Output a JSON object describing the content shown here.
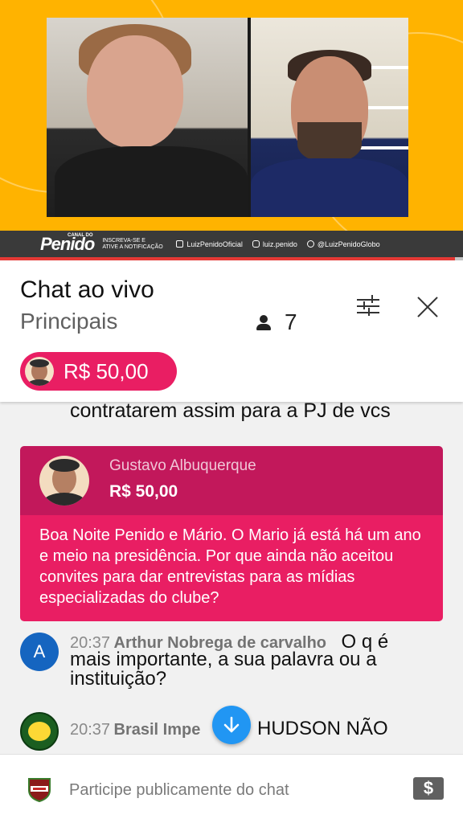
{
  "video": {
    "banner": {
      "channel_prefix": "CANAL DO",
      "logo": "Penido",
      "subscribe_line1": "INSCREVA-SE E",
      "subscribe_line2": "ATIVE A NOTIFICAÇÃO",
      "facebook": "LuizPenidoOficial",
      "instagram": "luiz.penido",
      "twitter": "@LuizPenidoGlobo"
    }
  },
  "header": {
    "title": "Chat ao vivo",
    "subtitle": "Principais",
    "viewer_count": "7",
    "pinned_superchat_amount": "R$ 50,00"
  },
  "chat": {
    "previous_message_tail": "contratarem assim para a PJ de vcs",
    "superchat": {
      "author": "Gustavo Albuquerque",
      "amount": "R$ 50,00",
      "message": "Boa Noite Penido e Mário. O Mario já está há um ano e meio na presidência. Por que ainda não aceitou convites para dar entrevistas para as mídias especializadas do clube?"
    },
    "messages": [
      {
        "avatar_letter": "A",
        "time": "20:37",
        "author": "Arthur Nobrega de carvalho",
        "text_start": "O q é",
        "text_rest": "mais importante, a sua palavra ou a instituição?"
      },
      {
        "time": "20:37",
        "author": "Brasil Impe",
        "text": "HUDSON NÃO"
      }
    ]
  },
  "input": {
    "placeholder": "Participe publicamente do chat",
    "value": "",
    "superchat_button": "$"
  },
  "colors": {
    "superchat_header": "#c2185b",
    "superchat_body": "#e91e63",
    "accent_blue": "#2196f3",
    "video_background": "#ffb300"
  }
}
